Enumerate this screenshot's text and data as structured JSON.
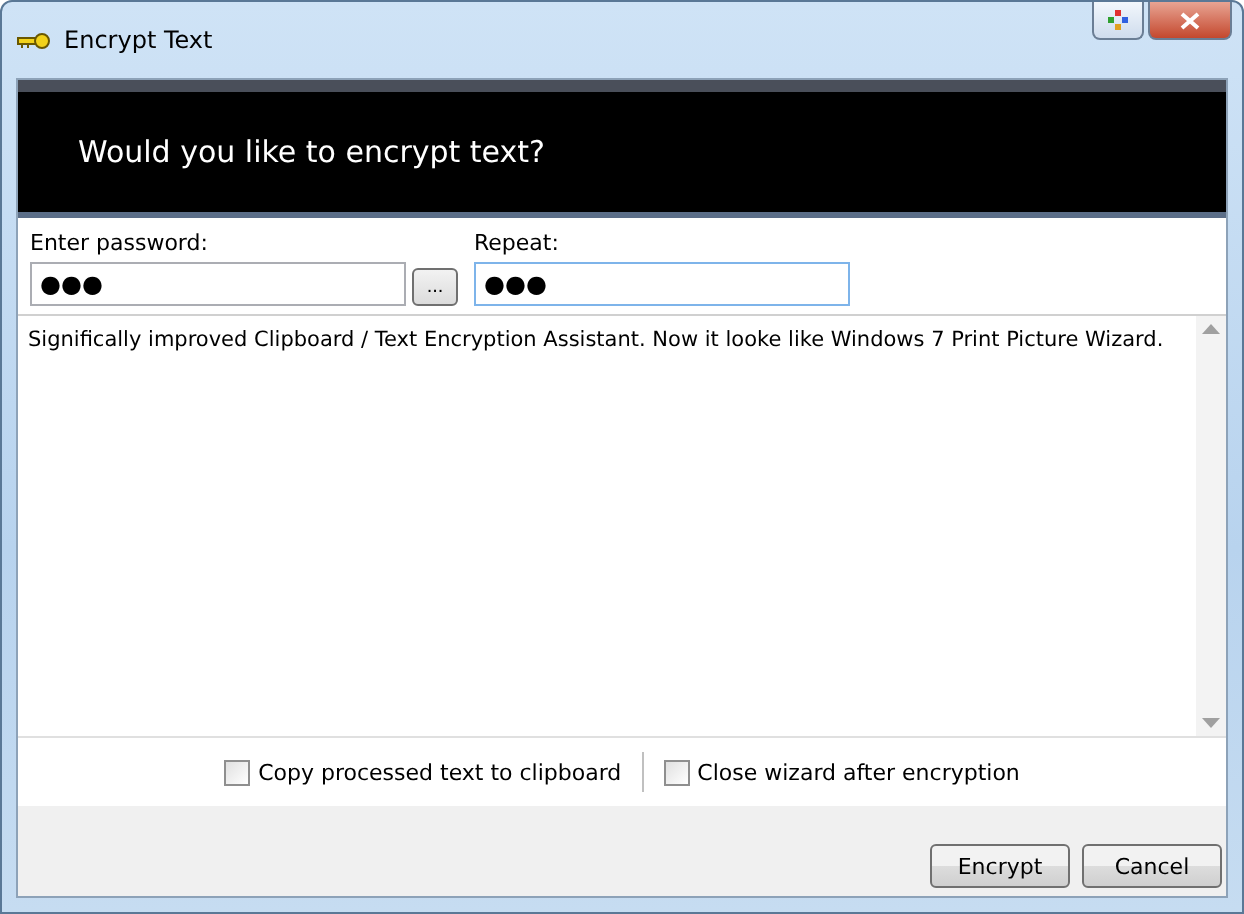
{
  "window": {
    "title": "Encrypt Text"
  },
  "header": {
    "title": "Would you like to encrypt text?"
  },
  "password": {
    "label": "Enter password:",
    "value": "●●●",
    "browse_button": "..."
  },
  "repeat": {
    "label": "Repeat:",
    "value": "●●●",
    "focused": true
  },
  "text_area": {
    "value": "Significally improved Clipboard / Text Encryption Assistant. Now it looke like Windows 7 Print Picture Wizard."
  },
  "options": [
    {
      "label": "Copy processed text to clipboard",
      "checked": false
    },
    {
      "label": "Close wizard after encryption",
      "checked": false
    }
  ],
  "buttons": [
    {
      "label": "Encrypt"
    },
    {
      "label": "Cancel"
    }
  ]
}
